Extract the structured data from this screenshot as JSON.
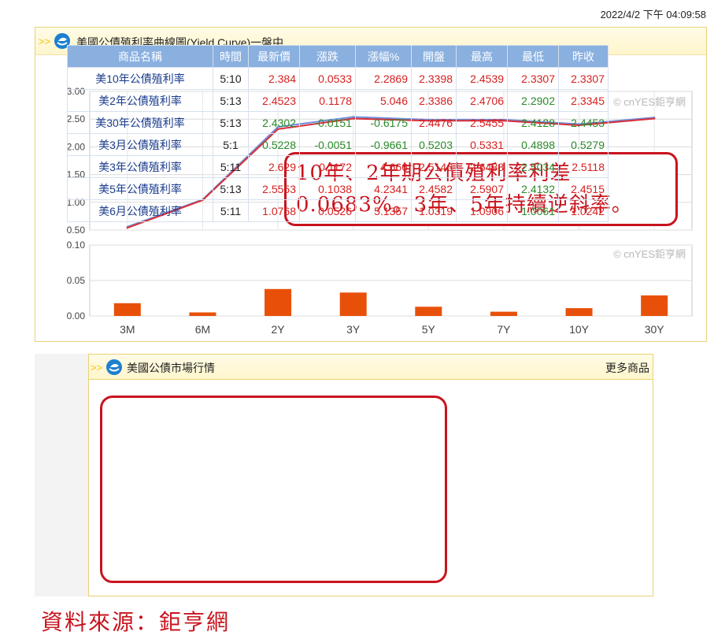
{
  "timestamp": "2022/4/2 下午 04:09:58",
  "yield_panel": {
    "title": "美國公債殖利率曲線圖(Yield Curve)一盤中",
    "watermark": "© cnYES鉅亨網"
  },
  "callout": {
    "line1": "10年、2年期公債殖利率利差",
    "line2": "0.0683%。3年、5年持續逆斜率。"
  },
  "chart_data": [
    {
      "type": "line",
      "title": "",
      "categories": [
        "3M",
        "6M",
        "2Y",
        "3Y",
        "5Y",
        "7Y",
        "10Y",
        "30Y"
      ],
      "series": [
        {
          "values": [
            0.56,
            1.05,
            2.36,
            2.54,
            2.49,
            2.49,
            2.41,
            2.53
          ],
          "color": "#6f8fd8"
        },
        {
          "values": [
            0.54,
            1.04,
            2.32,
            2.51,
            2.47,
            2.47,
            2.39,
            2.51
          ],
          "color": "#d8303a"
        }
      ],
      "ylim": [
        0.5,
        3.0
      ],
      "yticks": [
        "0.50",
        "1.00",
        "1.50",
        "2.00",
        "2.50",
        "3.00"
      ],
      "grid": true
    },
    {
      "type": "bar",
      "title": "",
      "categories": [
        "3M",
        "6M",
        "2Y",
        "3Y",
        "5Y",
        "7Y",
        "10Y",
        "30Y"
      ],
      "values": [
        0.018,
        0.005,
        0.038,
        0.033,
        0.013,
        0.006,
        0.011,
        0.029
      ],
      "color": "#e8500a",
      "ylim": [
        0,
        0.1
      ],
      "yticks": [
        "0.00",
        "0.05",
        "0.10"
      ],
      "grid": true
    }
  ],
  "market": {
    "title": "美國公債市場行情",
    "more": "更多商品",
    "headers": [
      "商品名稱",
      "時間",
      "最新價",
      "漲跌",
      "漲幅%",
      "開盤",
      "最高",
      "最低",
      "昨收"
    ],
    "rows": [
      {
        "name": "美10年公債殖利率",
        "time": "5:10",
        "price": "2.384",
        "chg": "0.0533",
        "pct": "2.2869",
        "open": "2.3398",
        "high": "2.4539",
        "low": "2.3307",
        "prev": "2.3307",
        "dir": "up"
      },
      {
        "name": "美2年公債殖利率",
        "time": "5:13",
        "price": "2.4523",
        "chg": "0.1178",
        "pct": "5.046",
        "open": "2.3386",
        "high": "2.4706",
        "low": "2.2902",
        "prev": "2.3345",
        "dir": "up"
      },
      {
        "name": "美30年公債殖利率",
        "time": "5:13",
        "price": "2.4302",
        "chg": "-0.0151",
        "pct": "-0.6175",
        "open": "2.4476",
        "high": "2.5455",
        "low": "2.4128",
        "prev": "2.4453",
        "dir": "down"
      },
      {
        "name": "美3月公債殖利率",
        "time": "5:1",
        "price": "0.5228",
        "chg": "-0.0051",
        "pct": "-0.9661",
        "open": "0.5203",
        "high": "0.5331",
        "low": "0.4898",
        "prev": "0.5279",
        "dir": "down"
      },
      {
        "name": "美3年公債殖利率",
        "time": "5:11",
        "price": "2.629",
        "chg": "0.1172",
        "pct": "4.666",
        "open": "2.5146",
        "high": "2.6488",
        "low": "2.5034",
        "prev": "2.5118",
        "dir": "up"
      },
      {
        "name": "美5年公債殖利率",
        "time": "5:13",
        "price": "2.5553",
        "chg": "0.1038",
        "pct": "4.2341",
        "open": "2.4582",
        "high": "2.5907",
        "low": "2.4132",
        "prev": "2.4515",
        "dir": "up"
      },
      {
        "name": "美6月公債殖利率",
        "time": "5:11",
        "price": "1.0768",
        "chg": "0.0526",
        "pct": "5.1357",
        "open": "1.0319",
        "high": "1.0906",
        "low": "1.0061",
        "prev": "1.0242",
        "dir": "up"
      }
    ]
  },
  "source": "資料來源：鉅亨網"
}
